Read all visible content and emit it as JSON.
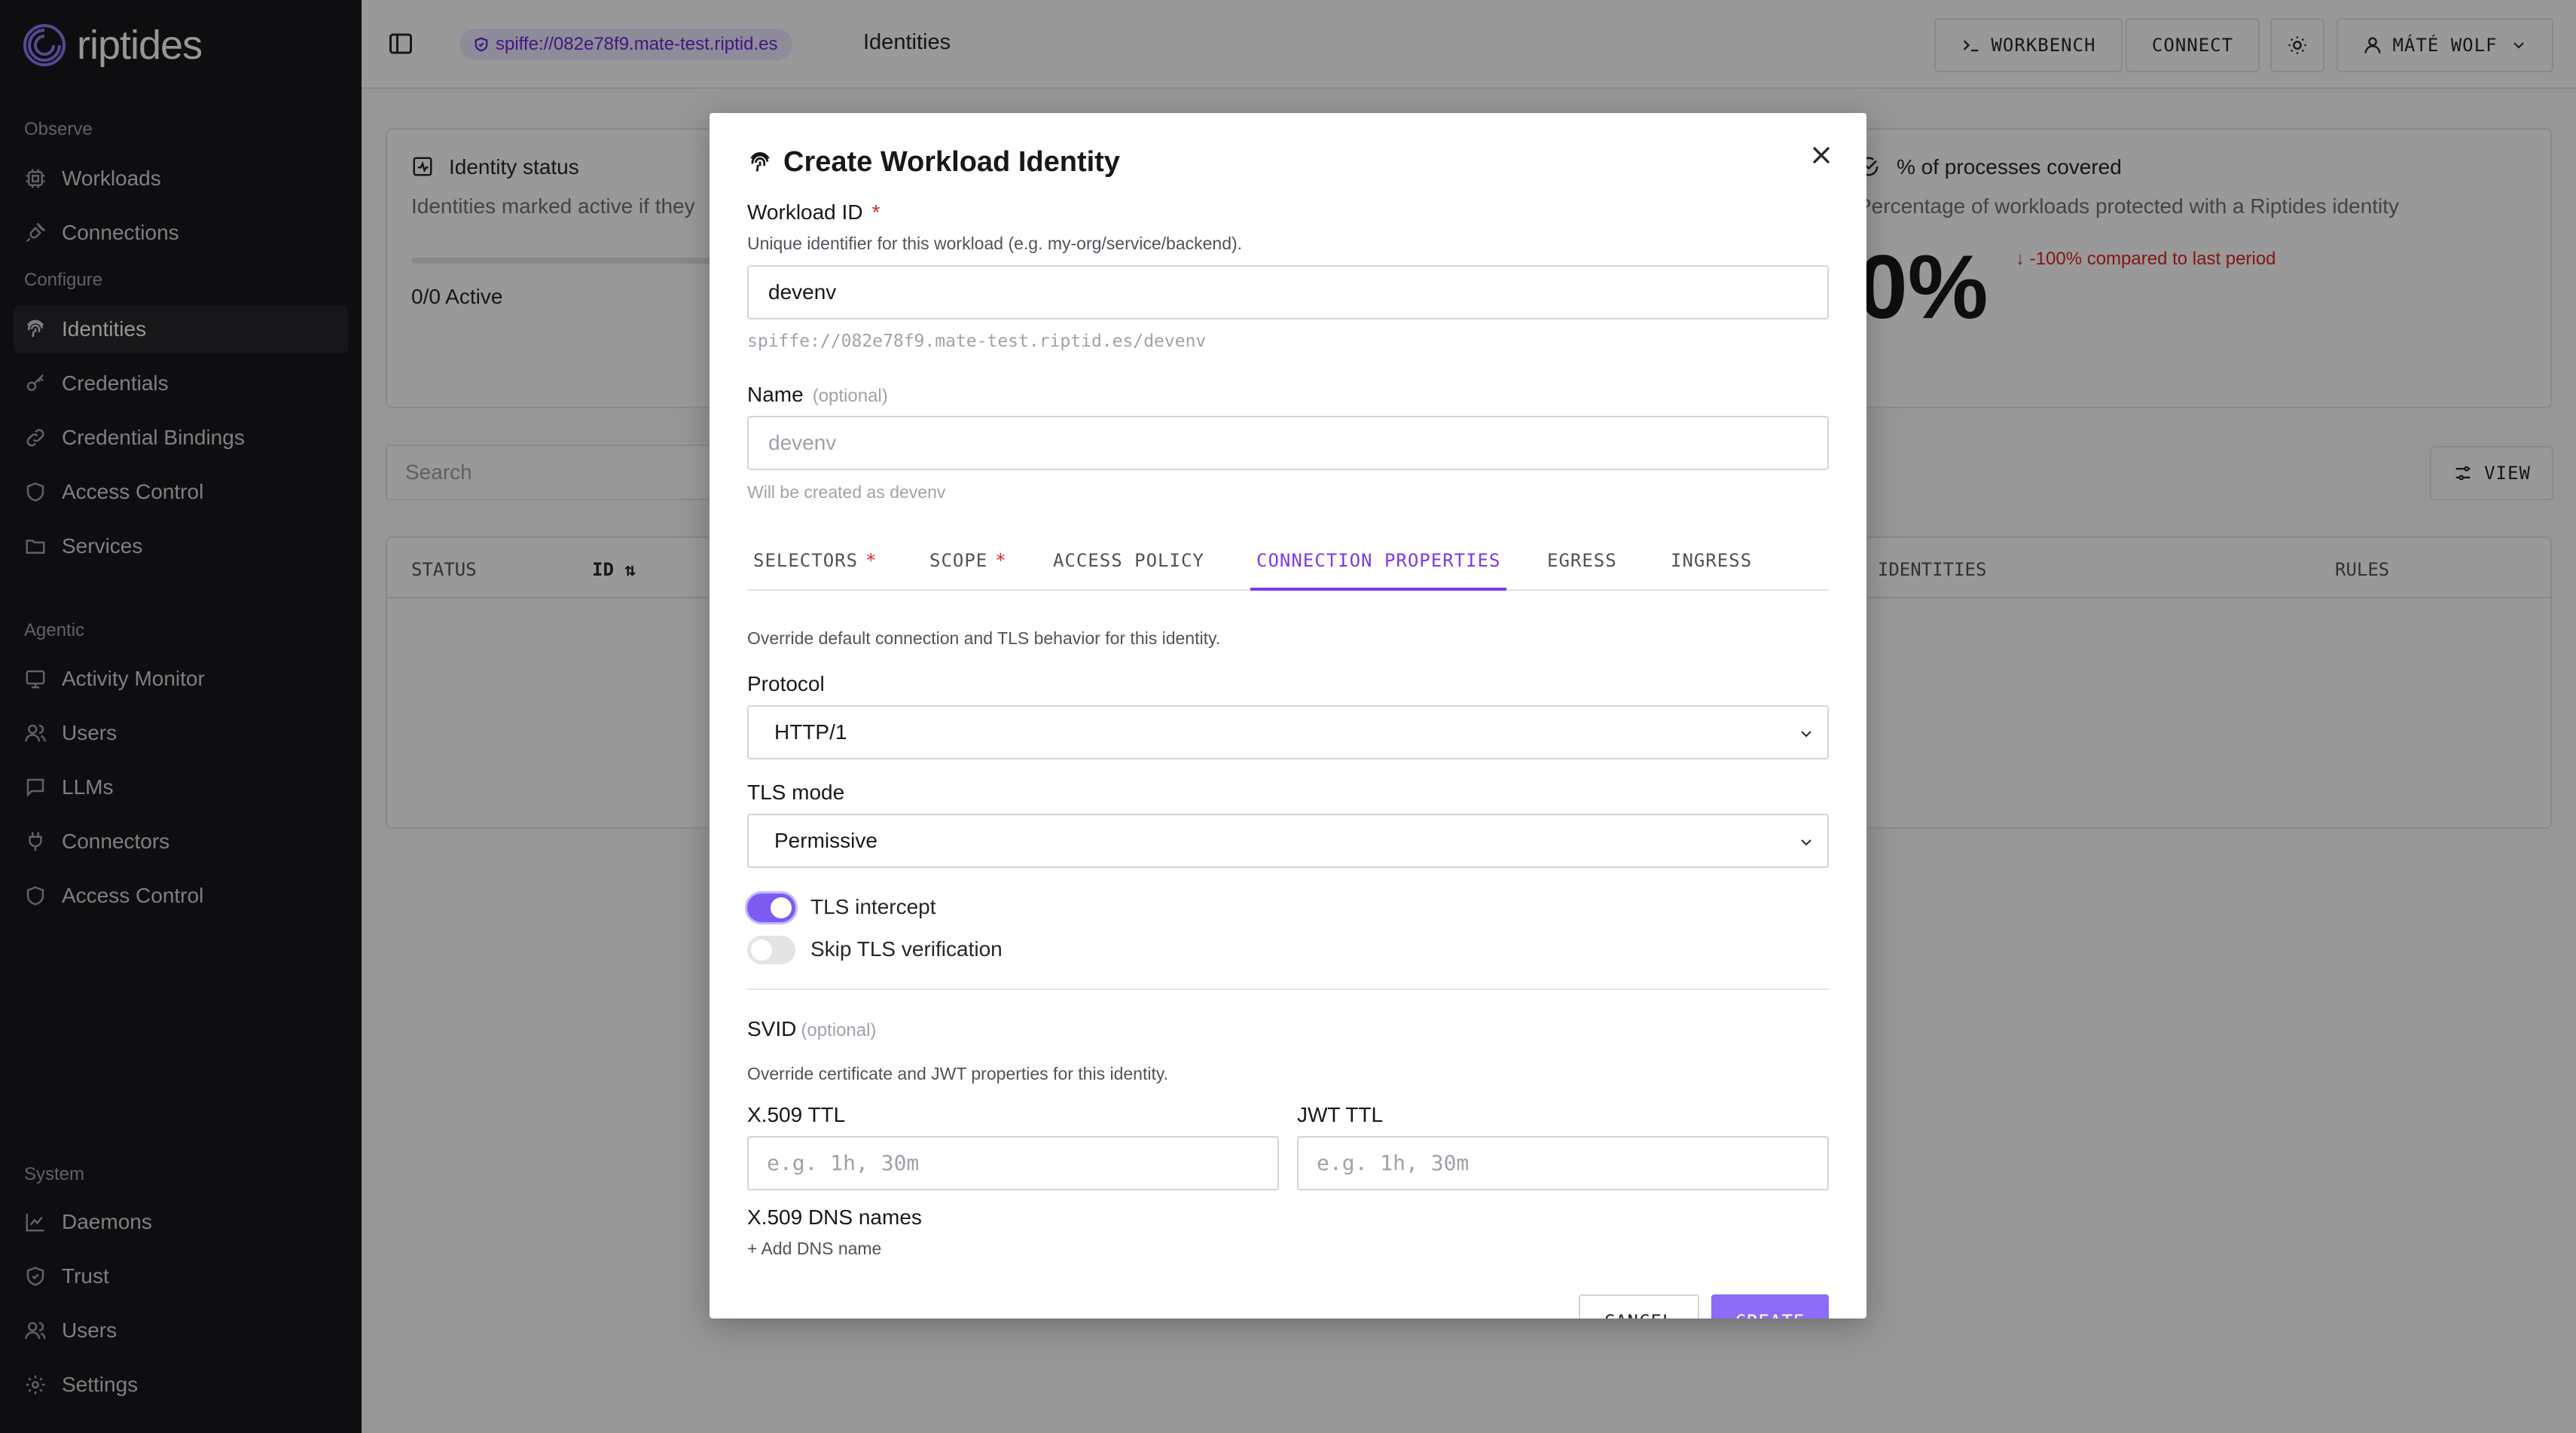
{
  "app": {
    "name": "riptides"
  },
  "sidebar": {
    "sections": {
      "observe": "Observe",
      "configure": "Configure",
      "agentic": "Agentic",
      "system": "System"
    },
    "items": [
      {
        "label": "Workloads",
        "icon": "cpu-icon"
      },
      {
        "label": "Connections",
        "icon": "plug-icon"
      },
      {
        "label": "Identities",
        "icon": "fingerprint-icon",
        "active": true
      },
      {
        "label": "Credentials",
        "icon": "key-icon"
      },
      {
        "label": "Credential Bindings",
        "icon": "link-icon"
      },
      {
        "label": "Access Control",
        "icon": "shield-icon"
      },
      {
        "label": "Services",
        "icon": "folder-icon"
      },
      {
        "label": "Activity Monitor",
        "icon": "monitor-icon"
      },
      {
        "label": "Users",
        "icon": "users-icon"
      },
      {
        "label": "LLMs",
        "icon": "chat-icon"
      },
      {
        "label": "Connectors",
        "icon": "connector-icon"
      },
      {
        "label": "Access Control",
        "icon": "shield-icon"
      },
      {
        "label": "Daemons",
        "icon": "chart-icon"
      },
      {
        "label": "Trust",
        "icon": "shield-check-icon"
      },
      {
        "label": "Users",
        "icon": "users-icon"
      },
      {
        "label": "Settings",
        "icon": "gear-icon"
      }
    ]
  },
  "topbar": {
    "spiffe": "spiffe://082e78f9.mate-test.riptid.es",
    "breadcrumb": "Identities",
    "workbench": "WORKBENCH",
    "connect": "CONNECT",
    "user": "MÁTÉ WOLF"
  },
  "background": {
    "identity_status_title": "Identity status",
    "identity_status_sub": "Identities marked active if they",
    "identity_status_value": "0/0 Active",
    "coverage_title": "% of processes covered",
    "coverage_sub": "Percentage of workloads protected with a Riptides identity",
    "coverage_value": "0%",
    "coverage_delta": "↓ -100% compared to last period",
    "search_placeholder": "Search",
    "view_btn": "VIEW",
    "col_status": "STATUS",
    "col_id": "ID",
    "col_identities": "D IDENTITIES",
    "col_rules": "RULES"
  },
  "modal": {
    "title": "Create Workload Identity",
    "workload_id_label": "Workload ID",
    "required_mark": "*",
    "workload_id_help": "Unique identifier for this workload (e.g. my-org/service/backend).",
    "workload_id_value": "devenv",
    "spiffe_preview": "spiffe://082e78f9.mate-test.riptid.es/devenv",
    "name_label": "Name",
    "optional_mark": "(optional)",
    "name_placeholder": "devenv",
    "name_hint": "Will be created as devenv",
    "tabs": [
      {
        "label": "SELECTORS",
        "required": true
      },
      {
        "label": "SCOPE",
        "required": true
      },
      {
        "label": "ACCESS POLICY",
        "required": false
      },
      {
        "label": "CONNECTION PROPERTIES",
        "required": false,
        "active": true
      },
      {
        "label": "EGRESS",
        "required": false
      },
      {
        "label": "INGRESS",
        "required": false
      }
    ],
    "conn_help": "Override default connection and TLS behavior for this identity.",
    "protocol_label": "Protocol",
    "protocol_value": "HTTP/1",
    "tls_mode_label": "TLS mode",
    "tls_mode_value": "Permissive",
    "tls_intercept_label": "TLS intercept",
    "tls_intercept_on": true,
    "skip_tls_label": "Skip TLS verification",
    "skip_tls_on": false,
    "svid_label": "SVID",
    "svid_help": "Override certificate and JWT properties for this identity.",
    "x509_ttl_label": "X.509 TTL",
    "x509_ttl_placeholder": "e.g. 1h, 30m",
    "jwt_ttl_label": "JWT TTL",
    "jwt_ttl_placeholder": "e.g. 1h, 30m",
    "dns_label": "X.509 DNS names",
    "add_dns": "+ Add DNS name",
    "cancel": "CANCEL",
    "create": "CREATE"
  }
}
